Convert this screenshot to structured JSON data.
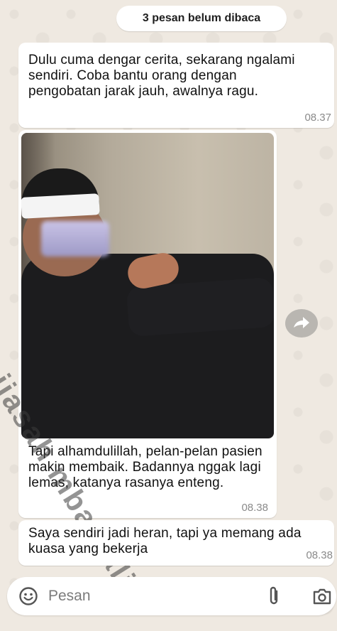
{
  "banner": {
    "unread": "3 pesan belum dibaca"
  },
  "messages": [
    {
      "text": "Dulu cuma dengar cerita, sekarang ngalami sendiri. Coba bantu orang dengan pengobatan jarak jauh, awalnya ragu.",
      "time": "08.37"
    },
    {
      "text": "Tapi alhamdulillah, pelan-pelan pasien makin membaik. Badannya nggak lagi lemas, katanya rasanya enteng.",
      "time": "08.38",
      "has_photo": true,
      "watermark": "ijasah mbah alin"
    },
    {
      "text": "Saya sendiri jadi heran, tapi ya memang ada kuasa yang bekerja",
      "time": "08.38"
    }
  ],
  "composer": {
    "placeholder": "Pesan"
  },
  "icons": {
    "emoji": "emoji-icon",
    "attach": "paperclip-icon",
    "camera": "camera-icon",
    "forward": "forward-icon"
  },
  "colors": {
    "background": "#efe9e1",
    "bubble": "#ffffff",
    "timestamp": "#8a8a8a",
    "icon": "#555555"
  }
}
